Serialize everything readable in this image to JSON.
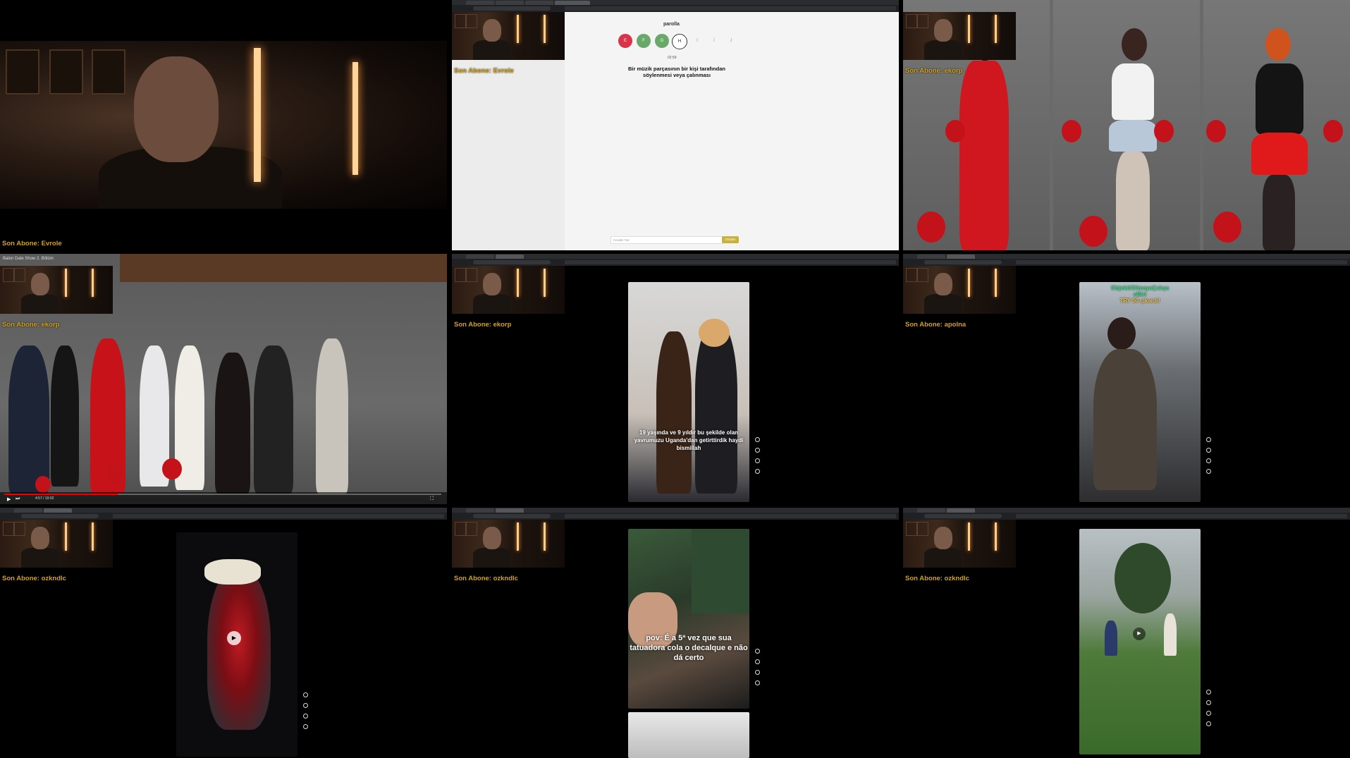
{
  "tiles": {
    "t0": {
      "subscriber": "Son Abone: Evrole"
    },
    "t1": {
      "subscriber": "Son Abone: Evrole",
      "app_name": "parolla",
      "letters": [
        "E",
        "F",
        "G",
        "H",
        "I",
        "İ",
        "J"
      ],
      "timer": "02:59",
      "question": "Bir müzik parçasının bir kişi tarafından söylenmesi veya çalınması",
      "answer_placeholder": "Cevabı Yaz",
      "send_label": "Gönder"
    },
    "t2": {
      "subscriber": "Son Abone: ekorp"
    },
    "t3": {
      "subscriber": "Son Abone: ekorp",
      "video_title": "Balon Date Show 2. Bölüm",
      "time": "4:57 / 19:02",
      "progress": 0.26
    },
    "t4": {
      "subscriber": "Son Abone: ekorp",
      "caption": "19 yaşında ve 9 yıldır bu şekilde olan yavrumuzu Uganda'dan getirttirdik haydi bismillah"
    },
    "t5": {
      "subscriber": "Son Abone: apolna",
      "overlay_lines": [
        "ObjektifOlmayaÇalışa",
        "nBiri",
        "TRY 50 çıkardı!"
      ]
    },
    "t6": {
      "subscriber": "Son Abone: ozkndlc"
    },
    "t7": {
      "subscriber": "Son Abone: ozkndlc",
      "caption": "pov: É a 5ª vez que sua tatuadora cola o decalque e não dá certo"
    },
    "t8": {
      "subscriber": "Son Abone: ozkndlc"
    }
  },
  "colors": {
    "subscriber_text": "#d4a21a",
    "red_letter": "#d9334a",
    "green_letter": "#6aa86a",
    "send_button": "#c8b23a",
    "overlay_green": "#3fe08a",
    "overlay_yellow": "#f4c542"
  }
}
